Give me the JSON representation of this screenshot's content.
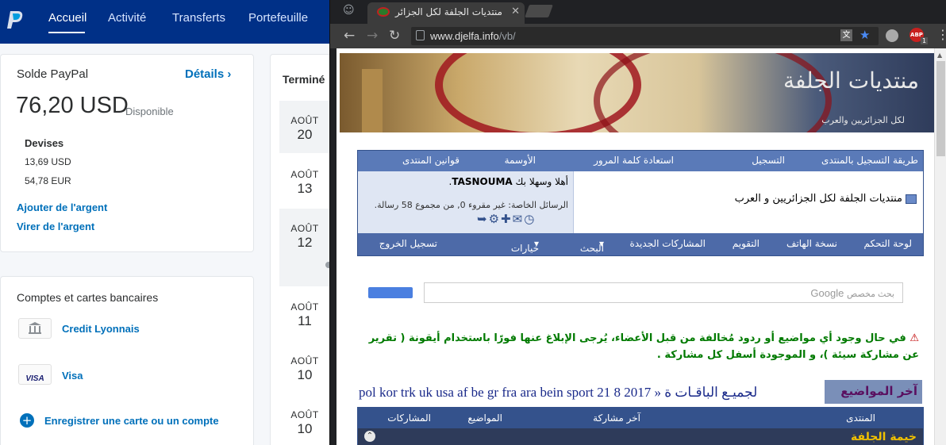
{
  "paypal": {
    "nav": [
      {
        "label": "Accueil",
        "active": true
      },
      {
        "label": "Activité",
        "active": false
      },
      {
        "label": "Transferts",
        "active": false
      },
      {
        "label": "Portefeuille",
        "active": false
      }
    ],
    "balance": {
      "title": "Solde PayPal",
      "details_link": "Détails",
      "amount": "76,20 USD",
      "available": "Disponible",
      "currencies_label": "Devises",
      "currencies": [
        "13,69 USD",
        "54,78 EUR"
      ],
      "add_money": "Ajouter de l'argent",
      "transfer_money": "Virer de l'argent"
    },
    "accounts": {
      "title": "Comptes et cartes bancaires",
      "items": [
        {
          "label": "Credit Lyonnais",
          "icon": "bank-icon"
        },
        {
          "label": "Visa",
          "icon": "visa-card-icon",
          "badge": "VISA"
        }
      ],
      "register_link": "Enregistrer une carte ou un compte"
    },
    "activity": {
      "header": "Terminé",
      "dates": [
        {
          "month": "AOÛT",
          "day": "20"
        },
        {
          "month": "AOÛT",
          "day": "13"
        },
        {
          "month": "AOÛT",
          "day": "12"
        },
        {
          "month": "AOÛT",
          "day": "11"
        },
        {
          "month": "AOÛT",
          "day": "10"
        },
        {
          "month": "AOÛT",
          "day": "10"
        }
      ]
    },
    "colors": {
      "brand": "#003087",
      "link": "#0070ba"
    }
  },
  "browser": {
    "tab_title": "منتديات الجلفة لكل الجزائر",
    "url_host": "www.djelfa.info",
    "url_path": "/vb/",
    "abp_badge": "ABP",
    "abp_count": "1"
  },
  "forum": {
    "banner_logo": "منتديات الجلفة",
    "banner_sub": "لكل الجزائريين والعرب",
    "top_links": [
      "طريقة التسجيل بالمنتدى",
      "التسجيل",
      "استعادة كلمة المرور",
      "الأوسمة",
      "قوانين المنتدى"
    ],
    "site_title": "منتديات الجلفة لكل الجزائريين و العرب",
    "welcome_prefix": "أهلا وسهلا بك",
    "username": "TASNOUMA",
    "pm_line": "الرسائل الخاصة: غير مقروء 0, من مجموع 58 رسالة.",
    "nav_links": [
      "لوحة التحكم",
      "نسخة الهاتف",
      "التقويم",
      "المشاركات الجديدة",
      "البحث",
      "خيارات سريعة",
      "تسجيل الخروج"
    ],
    "search_placeholder": "بحث مخصص",
    "google_label": "Google",
    "notice": "في حال وجود أي مواضيع أو ردود مُخالفة من قبل الأعضاء، يُرجى الإبلاغ عنها فورًا باستخدام أيقونة ( تقرير عن مشاركة سيئة )، و الموجودة أسفل كل مشاركة .",
    "latest_title": "آخر المواضيع",
    "marquee": "pol kor trk uk usa af be gr fra ara bein sport 21 8 2017 » لجميـع الباقـات ة",
    "table_headers": [
      "المنتدى",
      "آخر مشاركة",
      "المواضيع",
      "المشاركات"
    ],
    "section_label": "خيمة الجلفة"
  }
}
